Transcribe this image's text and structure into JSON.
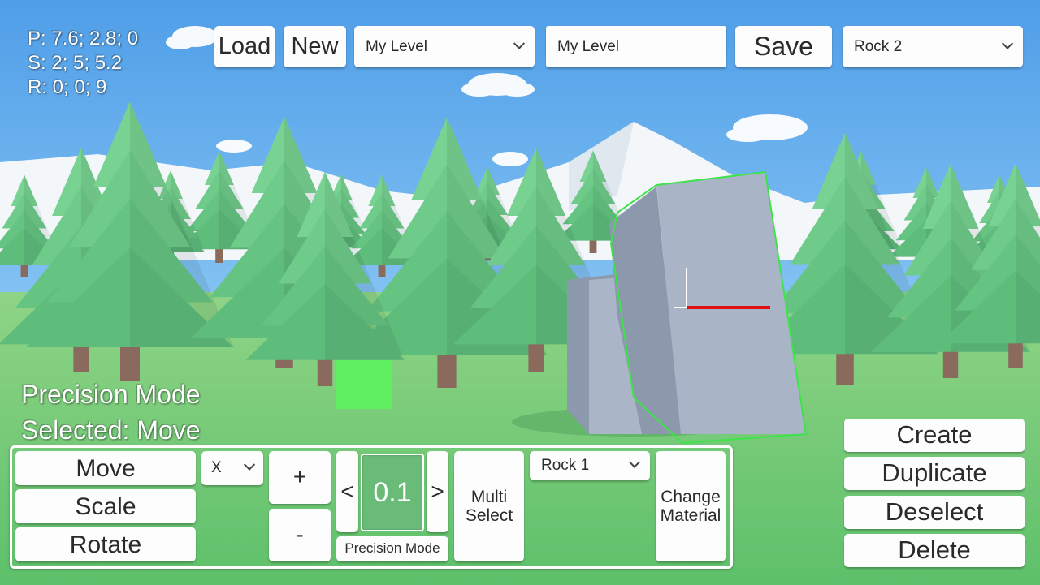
{
  "hud": {
    "position": "P: 7.6; 2.8; 0",
    "scale": "S: 2; 5; 5.2",
    "rotation": "R: 0; 0; 9"
  },
  "toolbar": {
    "load_label": "Load",
    "new_label": "New",
    "level_select": "My Level",
    "level_name_value": "My Level",
    "save_label": "Save",
    "object_select": "Rock 2"
  },
  "status": {
    "mode": "Precision Mode",
    "selected": "Selected: Move"
  },
  "tools": {
    "move_label": "Move",
    "scale_label": "Scale",
    "rotate_label": "Rotate",
    "axis_select": "X",
    "plus_label": "+",
    "minus_label": "-",
    "decrease_label": "<",
    "increase_label": ">",
    "precision_value": "0.1",
    "precision_mode_label": "Precision Mode",
    "multi_select_label": "Multi\nSelect",
    "material_select": "Rock 1",
    "change_material_label": "Change\nMaterial"
  },
  "actions": {
    "create_label": "Create",
    "duplicate_label": "Duplicate",
    "deselect_label": "Deselect",
    "delete_label": "Delete"
  },
  "colors": {
    "sky": "#6fb6ee",
    "grass": "#63c46f",
    "tree": "#6fcb8a",
    "rock": "#a7b2c4",
    "selection_outline": "#3ee34a",
    "x_axis": "#e01010",
    "precision_box": "#6aba78"
  }
}
